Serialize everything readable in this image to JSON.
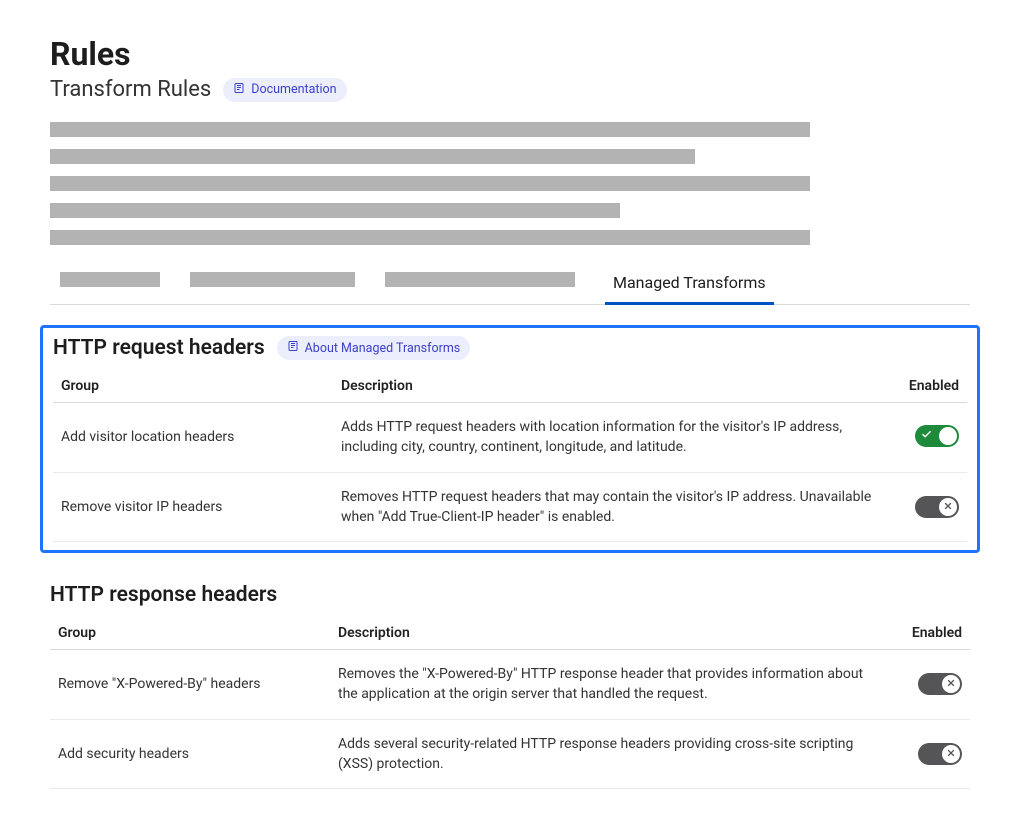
{
  "page": {
    "title": "Rules",
    "subtitle": "Transform Rules",
    "documentation_label": "Documentation"
  },
  "tabs": {
    "active": "Managed Transforms"
  },
  "sections": {
    "request": {
      "title": "HTTP request headers",
      "about_label": "About Managed Transforms",
      "columns": {
        "group": "Group",
        "description": "Description",
        "enabled": "Enabled"
      },
      "rows": [
        {
          "group": "Add visitor location headers",
          "description": "Adds HTTP request headers with location information for the visitor's IP address, including city, country, continent, longitude, and latitude.",
          "enabled": true
        },
        {
          "group": "Remove visitor IP headers",
          "description": "Removes HTTP request headers that may contain the visitor's IP address. Unavailable when \"Add True-Client-IP header\" is enabled.",
          "enabled": false
        }
      ]
    },
    "response": {
      "title": "HTTP response headers",
      "columns": {
        "group": "Group",
        "description": "Description",
        "enabled": "Enabled"
      },
      "rows": [
        {
          "group": "Remove \"X-Powered-By\" headers",
          "description": "Removes the \"X-Powered-By\" HTTP response header that provides information about the application at the origin server that handled the request.",
          "enabled": false
        },
        {
          "group": "Add security headers",
          "description": "Adds several security-related HTTP response headers providing cross-site scripting (XSS) protection.",
          "enabled": false
        }
      ]
    }
  }
}
